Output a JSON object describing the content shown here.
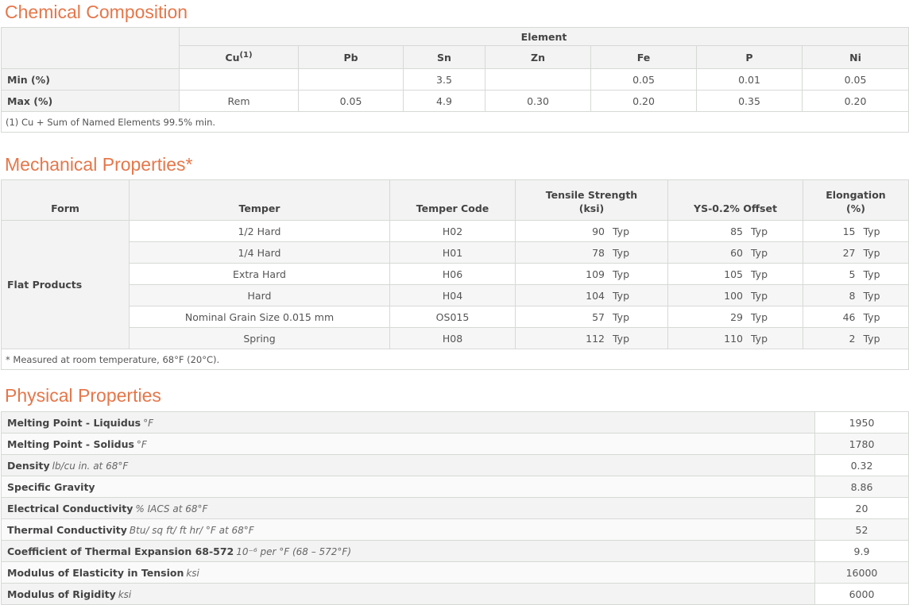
{
  "composition": {
    "title": "Chemical Composition",
    "group_header": "Element",
    "elements": [
      "Cu",
      "Pb",
      "Sn",
      "Zn",
      "Fe",
      "P",
      "Ni"
    ],
    "cu_sup": "(1)",
    "rows": [
      {
        "label": "Min (%)",
        "values": [
          "",
          "",
          "3.5",
          "",
          "0.05",
          "0.01",
          "0.05"
        ]
      },
      {
        "label": "Max (%)",
        "values": [
          "Rem",
          "0.05",
          "4.9",
          "0.30",
          "0.20",
          "0.35",
          "0.20"
        ]
      }
    ],
    "footnote": "(1) Cu + Sum of Named Elements 99.5% min."
  },
  "mechanical": {
    "title": "Mechanical Properties*",
    "headers": {
      "form": "Form",
      "temper": "Temper",
      "temper_code": "Temper Code",
      "tensile_1": "Tensile Strength",
      "tensile_2": "(ksi)",
      "ys": "YS-0.2% Offset",
      "elong_1": "Elongation",
      "elong_2": "(%)"
    },
    "form": "Flat Products",
    "typ_label": "Typ",
    "rows": [
      {
        "temper": "1/2 Hard",
        "code": "H02",
        "tensile": "90",
        "ys": "85",
        "elong": "15"
      },
      {
        "temper": "1/4 Hard",
        "code": "H01",
        "tensile": "78",
        "ys": "60",
        "elong": "27"
      },
      {
        "temper": "Extra Hard",
        "code": "H06",
        "tensile": "109",
        "ys": "105",
        "elong": "5"
      },
      {
        "temper": "Hard",
        "code": "H04",
        "tensile": "104",
        "ys": "100",
        "elong": "8"
      },
      {
        "temper": "Nominal Grain Size 0.015 mm",
        "code": "OS015",
        "tensile": "57",
        "ys": "29",
        "elong": "46"
      },
      {
        "temper": "Spring",
        "code": "H08",
        "tensile": "112",
        "ys": "110",
        "elong": "2"
      }
    ],
    "footnote": "* Measured at room temperature, 68°F (20°C)."
  },
  "physical": {
    "title": "Physical Properties",
    "rows": [
      {
        "name": "Melting Point - Liquidus",
        "unit": "°F",
        "value": "1950"
      },
      {
        "name": "Melting Point - Solidus",
        "unit": "°F",
        "value": "1780"
      },
      {
        "name": "Density",
        "unit": "lb/cu in. at 68°F",
        "value": "0.32"
      },
      {
        "name": "Specific Gravity",
        "unit": "",
        "value": "8.86"
      },
      {
        "name": "Electrical Conductivity",
        "unit": "% IACS at 68°F",
        "value": "20"
      },
      {
        "name": "Thermal Conductivity",
        "unit": "Btu/ sq ft/ ft hr/ °F at 68°F",
        "value": "52"
      },
      {
        "name": "Coefficient of Thermal Expansion 68-572",
        "unit": "10⁻⁶ per °F (68 – 572°F)",
        "value": "9.9"
      },
      {
        "name": "Modulus of Elasticity in Tension",
        "unit": "ksi",
        "value": "16000"
      },
      {
        "name": "Modulus of Rigidity",
        "unit": "ksi",
        "value": "6000"
      }
    ]
  }
}
